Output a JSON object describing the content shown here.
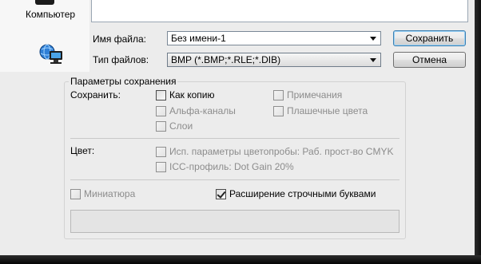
{
  "places": {
    "computer_label": "Компьютер"
  },
  "file": {
    "name_label": "Имя файла:",
    "name_value": "Без имени-1",
    "type_label": "Тип файлов:",
    "type_value": "BMP (*.BMP;*.RLE;*.DIB)"
  },
  "buttons": {
    "save": "Сохранить",
    "cancel": "Отмена"
  },
  "save_params": {
    "title": "Параметры сохранения",
    "save_label": "Сохранить:",
    "as_copy": {
      "label": "Как копию",
      "checked": false,
      "enabled": true
    },
    "notes": {
      "label": "Примечания",
      "checked": false,
      "enabled": false
    },
    "alpha": {
      "label": "Альфа-каналы",
      "checked": false,
      "enabled": false
    },
    "spot": {
      "label": "Плашечные цвета",
      "checked": false,
      "enabled": false
    },
    "layers": {
      "label": "Слои",
      "checked": false,
      "enabled": false
    }
  },
  "color": {
    "label": "Цвет:",
    "proof": {
      "label": "Исп. параметры цветопробы:  Раб. прост-во CMYK",
      "checked": false,
      "enabled": false
    },
    "icc": {
      "label": "ICC-профиль:  Dot Gain 20%",
      "checked": false,
      "enabled": false
    }
  },
  "thumbnail": {
    "label": "Миниатюра",
    "checked": false,
    "enabled": false
  },
  "lowercase_ext": {
    "label": "Расширение строчными буквами",
    "checked": true,
    "enabled": true
  },
  "colors": {
    "dialog_bg": "#ececec",
    "frame": "#0b0b0b"
  }
}
